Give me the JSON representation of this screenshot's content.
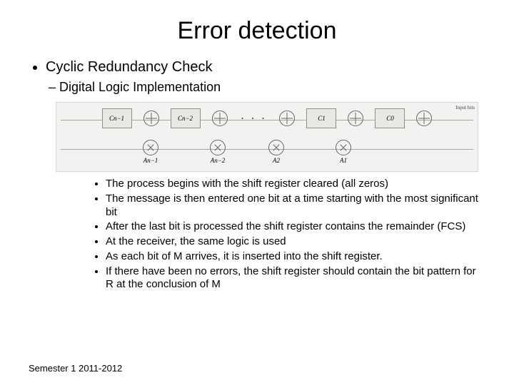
{
  "title": "Error detection",
  "bullet1": "Cyclic Redundancy Check",
  "bullet2": "Digital Logic Implementation",
  "diagram": {
    "input_label": "Input\nbits",
    "regs": [
      "Cn−1",
      "Cn−2",
      "C1",
      "C0"
    ],
    "coeffs": [
      "An−1",
      "An−2",
      "A2",
      "A1"
    ],
    "ellipsis": "· · ·"
  },
  "sub_bullets": [
    "The process begins with the shift register cleared (all zeros)",
    "The message is then entered one bit at a time starting with the most significant bit",
    "After the last bit is processed the shift register contains the remainder (FCS)",
    "At the receiver, the same logic is used",
    "As each bit of M arrives, it is inserted into the shift register.",
    "If there have been no errors, the shift register should contain the bit pattern for R at the conclusion of M"
  ],
  "footer": "Semester 1 2011-2012"
}
